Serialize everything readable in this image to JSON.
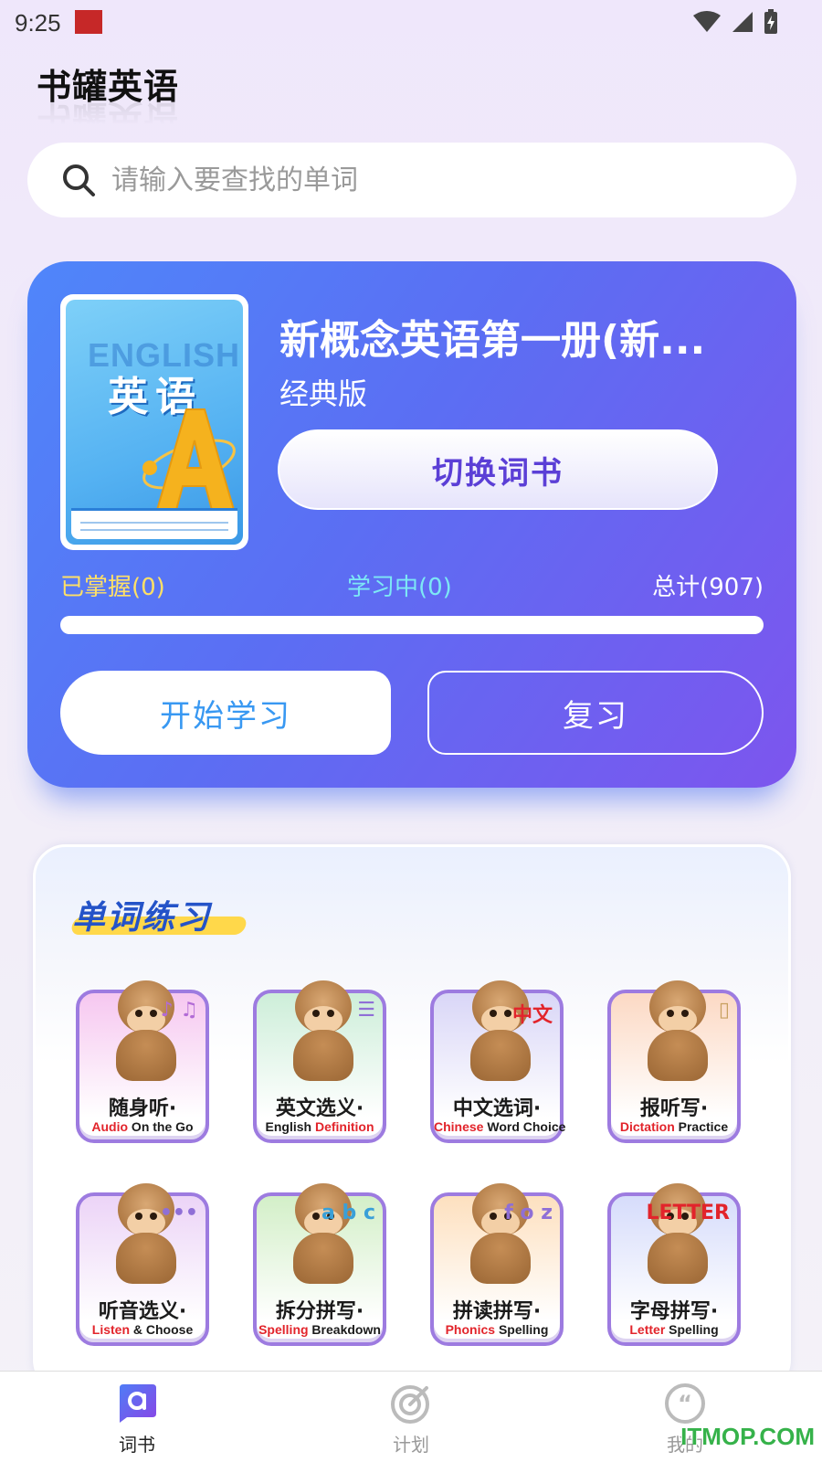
{
  "status_bar": {
    "time": "9:25"
  },
  "header": {
    "title": "书罐英语"
  },
  "search": {
    "placeholder": "请输入要查找的单词"
  },
  "book": {
    "cover_english": "ENGLISH",
    "cover_title": "英语",
    "title": "新概念英语第一册(新...",
    "edition": "经典版",
    "switch_label": "切换词书",
    "mastered_label": "已掌握(0)",
    "learning_label": "学习中(0)",
    "total_label": "总计(907)",
    "mastered": 0,
    "learning": 0,
    "total": 907,
    "progress_fraction": 0,
    "start_label": "开始学习",
    "review_label": "复习"
  },
  "practice": {
    "title": "单词练习",
    "items": [
      {
        "cn": "随身听·",
        "en_hl": "Audio",
        "en_rest": " On the Go",
        "deco": "♪ ♫",
        "bg": "#f6c7f0",
        "accent": "#b26bd6"
      },
      {
        "cn": "英文选义·",
        "en_hl": "",
        "en_rest": "English ",
        "en_hl2": "Definition",
        "deco": "☰",
        "bg": "#cdeed9",
        "accent": "#8f6fd6"
      },
      {
        "cn": "中文选词·",
        "en_hl": "Chinese",
        "en_rest": " Word Choice",
        "deco": "中文",
        "bg": "#d9d6f7",
        "accent": "#e2242b"
      },
      {
        "cn": "报听写·",
        "en_hl": "Dictation",
        "en_rest": " Practice",
        "deco": "▯",
        "bg": "#fcd9c4",
        "accent": "#c8a060"
      },
      {
        "cn": "听音选义·",
        "en_hl": "Listen",
        "en_rest": " & Choose",
        "deco": "•••",
        "bg": "#ecd4f7",
        "accent": "#8f6fd6"
      },
      {
        "cn": "拆分拼写·",
        "en_hl": "Spelling",
        "en_rest": " Breakdown",
        "deco": "a b c",
        "bg": "#d3efc8",
        "accent": "#3aa0d8"
      },
      {
        "cn": "拼读拼写·",
        "en_hl": "Phonics",
        "en_rest": " Spelling",
        "deco": "f o z",
        "bg": "#fde0bf",
        "accent": "#8f6fd6"
      },
      {
        "cn": "字母拼写·",
        "en_hl": "Letter",
        "en_rest": " Spelling",
        "deco": "LETTER",
        "bg": "#d6dcfb",
        "accent": "#e2242b"
      }
    ]
  },
  "bottom_nav": {
    "items": [
      {
        "label": "词书",
        "icon": "book-a-icon",
        "active": true
      },
      {
        "label": "计划",
        "icon": "target-icon",
        "active": false
      },
      {
        "label": "我的",
        "icon": "quote-icon",
        "active": false
      }
    ]
  },
  "watermark": "ITMOP.COM",
  "colors": {
    "card_gradient_start": "#4f86fa",
    "card_gradient_end": "#7d55ee",
    "mastered": "#ffe066",
    "learning": "#7de8f5",
    "start_text": "#3898f2",
    "switch_text": "#5b3fd6",
    "practice_title": "#2453c8"
  }
}
